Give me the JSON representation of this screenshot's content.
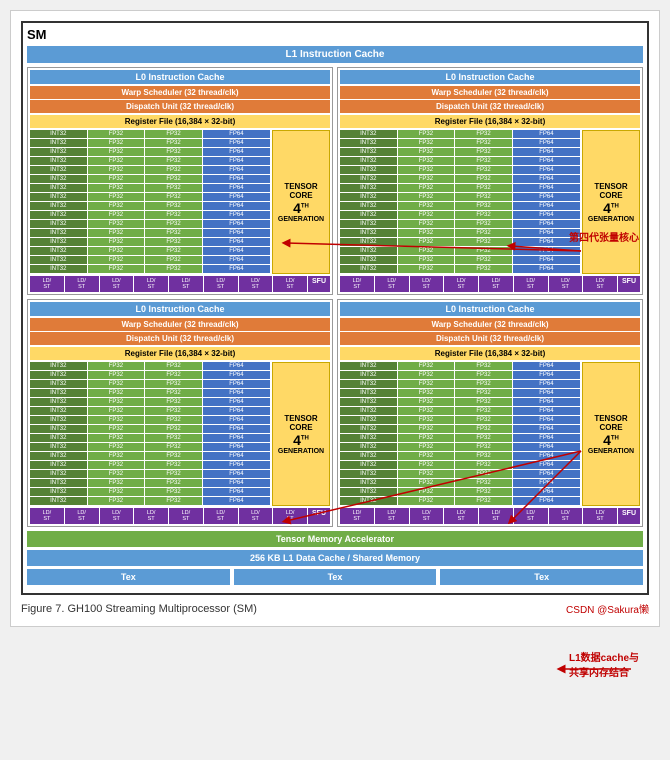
{
  "page": {
    "title": "SM",
    "l1_instruction_cache": "L1 Instruction Cache",
    "tensor_memory": "Tensor Memory Accelerator",
    "l1_data_cache": "256 KB L1 Data Cache / Shared Memory",
    "figure_caption": "Figure 7.    GH100 Streaming Multiprocessor (SM)",
    "csdn_author": "CSDN @Sakura懒",
    "annotation1": "第四代张量核心",
    "annotation2": "L1数据cache与\n共享内存结合",
    "quadrants": [
      {
        "l0": "L0 Instruction Cache",
        "warp": "Warp Scheduler (32 thread/clk)",
        "dispatch": "Dispatch Unit (32 thread/clk)",
        "register": "Register File (16,384 × 32-bit)",
        "tensor_label": "TENSOR CORE",
        "tensor_gen": "4",
        "tensor_suffix": "TH GENERATION"
      },
      {
        "l0": "L0 Instruction Cache",
        "warp": "Warp Scheduler (32 thread/clk)",
        "dispatch": "Dispatch Unit (32 thread/clk)",
        "register": "Register File (16,384 × 32-bit)",
        "tensor_label": "TENSOR CORE",
        "tensor_gen": "4",
        "tensor_suffix": "TH GENERATION"
      },
      {
        "l0": "L0 Instruction Cache",
        "warp": "Warp Scheduler (32 thread/clk)",
        "dispatch": "Dispatch Unit (32 thread/clk)",
        "register": "Register File (16,384 × 32-bit)",
        "tensor_label": "TENSOR CORE",
        "tensor_gen": "4",
        "tensor_suffix": "TH GENERATION"
      },
      {
        "l0": "L0 Instruction Cache",
        "warp": "Warp Scheduler (32 thread/clk)",
        "dispatch": "Dispatch Unit (32 thread/clk)",
        "register": "Register File (16,384 × 32-bit)",
        "tensor_label": "TENSOR CORE",
        "tensor_gen": "4",
        "tensor_suffix": "TH GENERATION"
      }
    ],
    "tex_units": [
      "Tex",
      "Tex",
      "Tex"
    ],
    "core_rows": 16,
    "ld_st_count": 8,
    "colors": {
      "blue": "#5b9bd5",
      "orange": "#e07b39",
      "yellow": "#ffd966",
      "green_dark": "#548235",
      "green_light": "#70ad47",
      "blue_core": "#4472c4",
      "purple": "#7030a0",
      "red_arrow": "#c00000"
    }
  }
}
